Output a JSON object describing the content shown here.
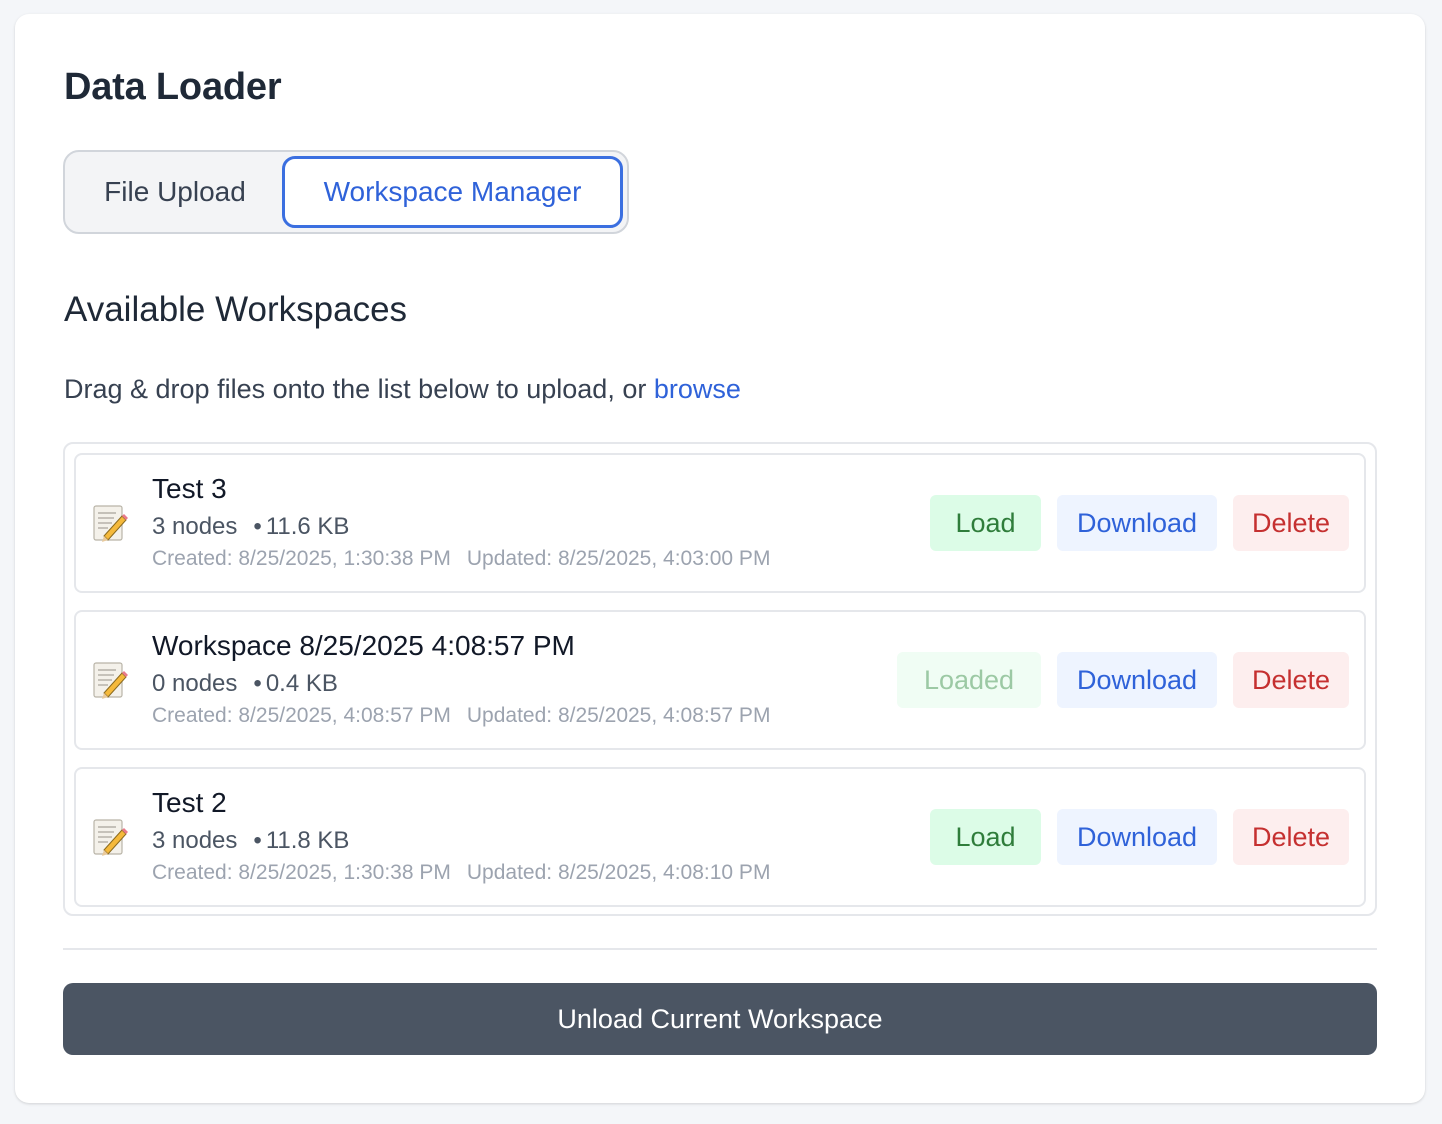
{
  "header": {
    "title": "Data Loader"
  },
  "tabs": [
    {
      "label": "File Upload",
      "active": false
    },
    {
      "label": "Workspace Manager",
      "active": true
    }
  ],
  "section": {
    "title": "Available Workspaces",
    "hint_text": "Drag & drop files onto the list below to upload, or ",
    "hint_link": "browse"
  },
  "workspaces": [
    {
      "icon": "memo-icon",
      "name": "Test 3",
      "nodes": "3 nodes",
      "bullet": "•",
      "size": "11.6 KB",
      "created": "Created: 8/25/2025, 1:30:38 PM",
      "updated": "Updated: 8/25/2025, 4:03:00 PM",
      "load_label": "Load",
      "loaded": false,
      "download_label": "Download",
      "delete_label": "Delete"
    },
    {
      "icon": "memo-icon",
      "name": "Workspace 8/25/2025 4:08:57 PM",
      "nodes": "0 nodes",
      "bullet": "•",
      "size": "0.4 KB",
      "created": "Created: 8/25/2025, 4:08:57 PM",
      "updated": "Updated: 8/25/2025, 4:08:57 PM",
      "load_label": "Loaded",
      "loaded": true,
      "download_label": "Download",
      "delete_label": "Delete"
    },
    {
      "icon": "memo-icon",
      "name": "Test 2",
      "nodes": "3 nodes",
      "bullet": "•",
      "size": "11.8 KB",
      "created": "Created: 8/25/2025, 1:30:38 PM",
      "updated": "Updated: 8/25/2025, 4:08:10 PM",
      "load_label": "Load",
      "loaded": false,
      "download_label": "Download",
      "delete_label": "Delete"
    }
  ],
  "footer": {
    "unload_label": "Unload Current Workspace"
  },
  "colors": {
    "accent": "#2f62d9",
    "load_bg": "#dcfce7",
    "load_text": "#2f7d3b",
    "download_bg": "#eef4ff",
    "delete_bg": "#fdeeee",
    "delete_text": "#c53030",
    "unload_bg": "#4b5563"
  }
}
